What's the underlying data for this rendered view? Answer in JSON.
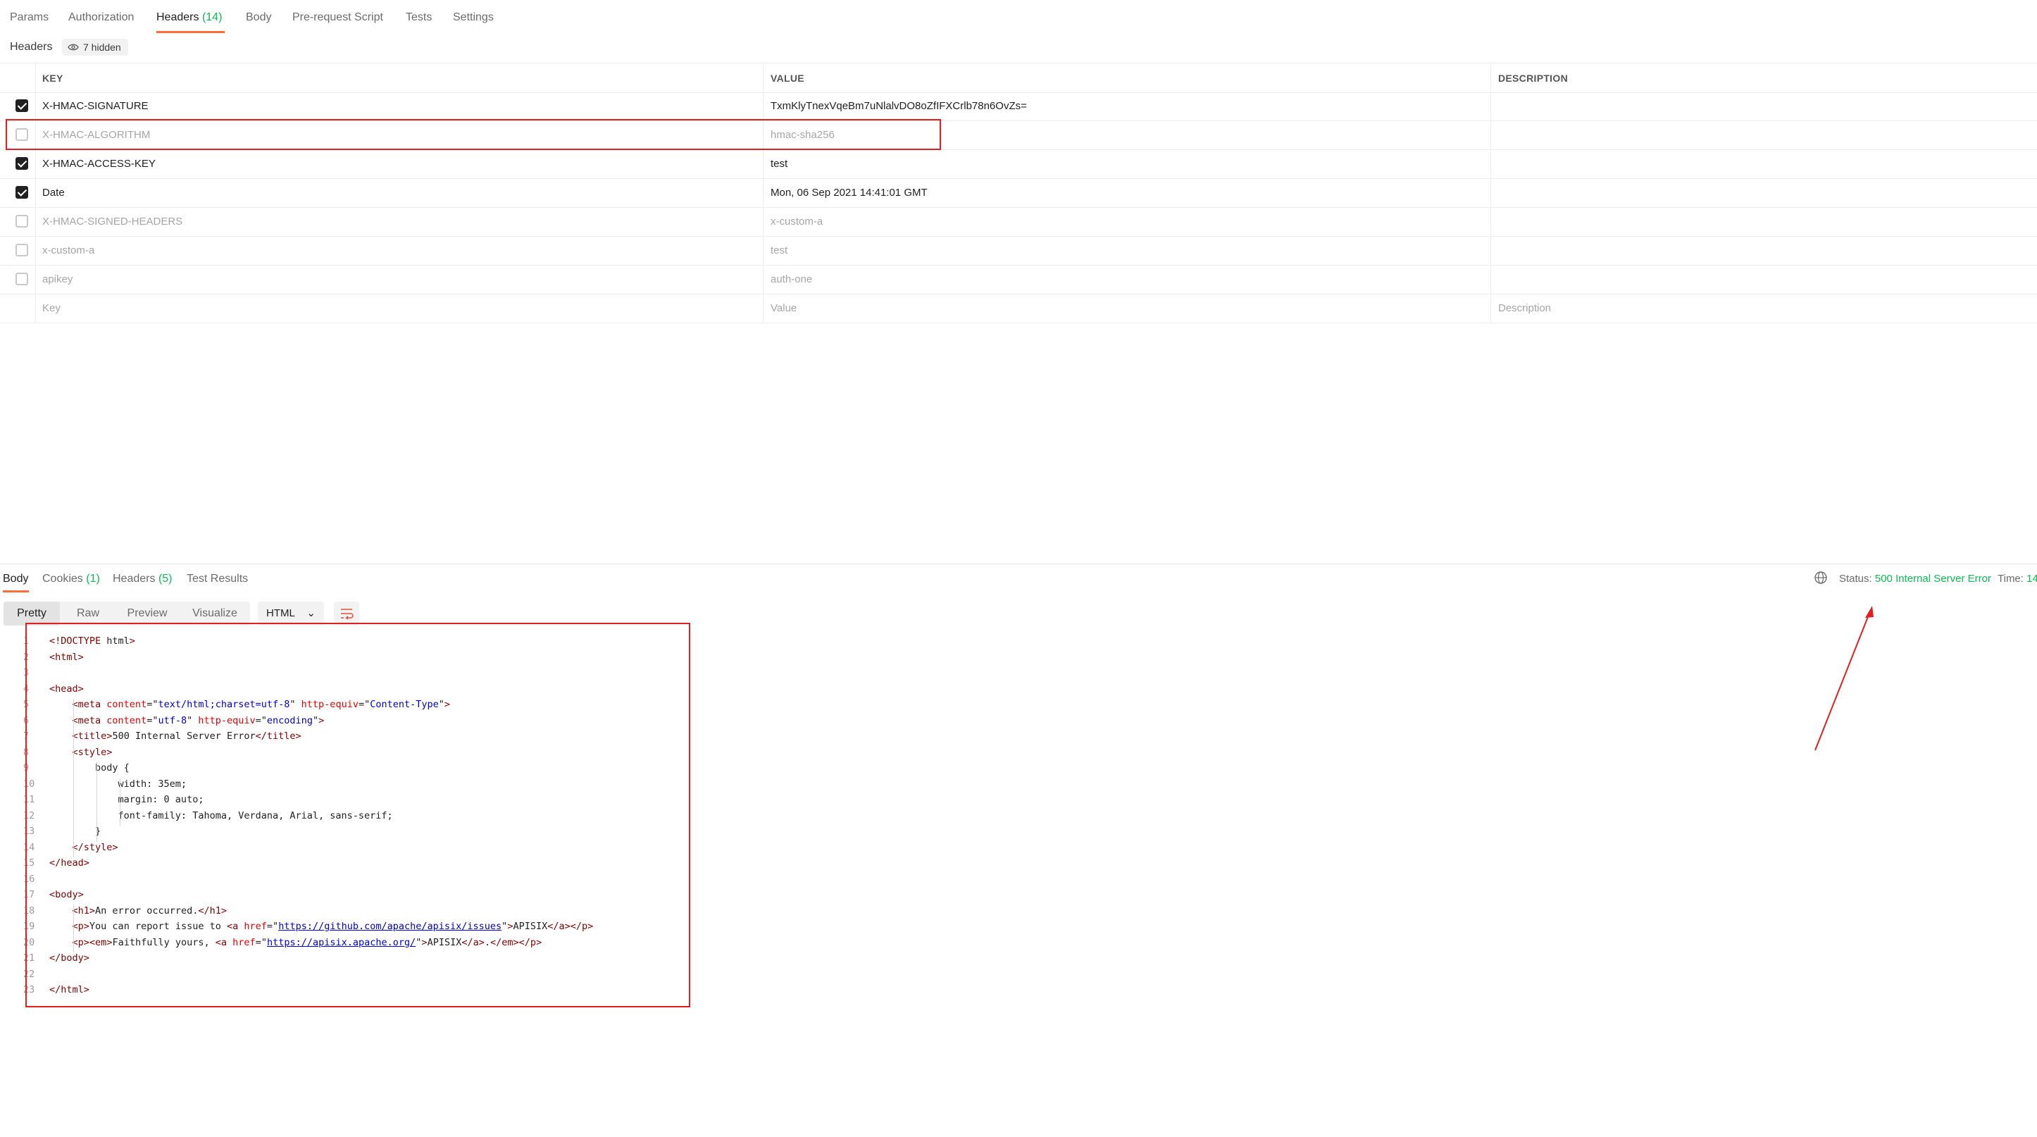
{
  "request_tabs": [
    {
      "label": "Params",
      "count": ""
    },
    {
      "label": "Authorization",
      "count": ""
    },
    {
      "label": "Headers",
      "count": "(14)"
    },
    {
      "label": "Body",
      "count": ""
    },
    {
      "label": "Pre-request Script",
      "count": ""
    },
    {
      "label": "Tests",
      "count": ""
    },
    {
      "label": "Settings",
      "count": ""
    }
  ],
  "headers_section": {
    "label": "Headers",
    "hidden_label": "7 hidden"
  },
  "table": {
    "columns": [
      "KEY",
      "VALUE",
      "DESCRIPTION"
    ],
    "rows": [
      {
        "checked": true,
        "key": "X-HMAC-SIGNATURE",
        "value": "TxmKlyTnexVqeBm7uNlalvDO8oZfIFXCrlb78n6OvZs="
      },
      {
        "checked": false,
        "key": "X-HMAC-ALGORITHM",
        "value": "hmac-sha256"
      },
      {
        "checked": true,
        "key": "X-HMAC-ACCESS-KEY",
        "value": "test"
      },
      {
        "checked": true,
        "key": "Date",
        "value": "Mon, 06 Sep 2021 14:41:01 GMT"
      },
      {
        "checked": false,
        "key": "X-HMAC-SIGNED-HEADERS",
        "value": "x-custom-a"
      },
      {
        "checked": false,
        "key": "x-custom-a",
        "value": "test"
      },
      {
        "checked": false,
        "key": "apikey",
        "value": "auth-one"
      }
    ],
    "placeholders": {
      "key": "Key",
      "value": "Value",
      "description": "Description"
    }
  },
  "response_tabs": [
    {
      "label": "Body",
      "count": ""
    },
    {
      "label": "Cookies",
      "count": "(1)"
    },
    {
      "label": "Headers",
      "count": "(5)"
    },
    {
      "label": "Test Results",
      "count": ""
    }
  ],
  "status": {
    "label": "Status:",
    "value": "500 Internal Server Error",
    "time_label": "Time:",
    "time_value": "14"
  },
  "view_modes": [
    "Pretty",
    "Raw",
    "Preview",
    "Visualize"
  ],
  "language": "HTML",
  "code": {
    "line_numbers": [
      "1",
      "2",
      "3",
      "4",
      "5",
      "6",
      "7",
      "8",
      "9",
      "10",
      "11",
      "12",
      "13",
      "14",
      "15",
      "16",
      "17",
      "18",
      "19",
      "20",
      "21",
      "22",
      "23"
    ],
    "lines": [
      "<!DOCTYPE html>",
      "<html>",
      "",
      "<head>",
      "    <meta content=\"text/html;charset=utf-8\" http-equiv=\"Content-Type\">",
      "    <meta content=\"utf-8\" http-equiv=\"encoding\">",
      "    <title>500 Internal Server Error</title>",
      "    <style>",
      "        body {",
      "            width: 35em;",
      "            margin: 0 auto;",
      "            font-family: Tahoma, Verdana, Arial, sans-serif;",
      "        }",
      "    </style>",
      "</head>",
      "",
      "<body>",
      "    <h1>An error occurred.</h1>",
      "    <p>You can report issue to <a href=\"https://github.com/apache/apisix/issues\">APISIX</a></p>",
      "    <p><em>Faithfully yours, <a href=\"https://apisix.apache.org/\">APISIX</a>.</em></p>",
      "</body>",
      "",
      "</html>"
    ]
  },
  "colors": {
    "accent": "#ff6c37",
    "success": "#0cbb52",
    "annotation": "#e02020"
  }
}
